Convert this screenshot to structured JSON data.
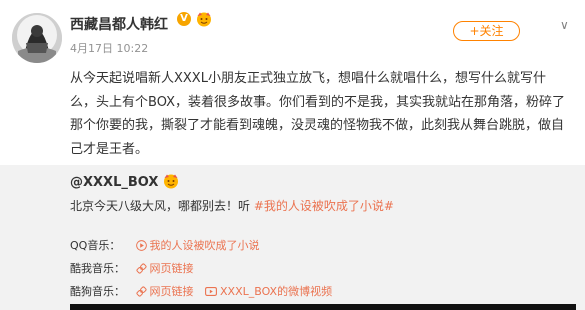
{
  "user": {
    "name": "西藏昌都人韩红",
    "verified_badge": "V",
    "timestamp": "4月17日 10:22"
  },
  "actions": {
    "follow_label": "+关注",
    "more_label": "∨"
  },
  "post": {
    "text": "从今天起说唱新人XXXL小朋友正式独立放飞，想唱什么就唱什么，想写什么就写什么，头上有个BOX，装着很多故事。你们看到的不是我，其实我就站在那角落，粉碎了那个你要的我，撕裂了才能看到魂魄，没灵魂的怪物我不做，此刻我从舞台跳脱，做自己才是王者。"
  },
  "repost": {
    "user": "@XXXL_BOX",
    "text_prefix": "北京今天八级大风，哪都别去！听 ",
    "hashtag": "#我的人设被吹成了小说#",
    "music": [
      {
        "label": "QQ音乐：",
        "links": [
          {
            "icon": "play-icon",
            "text": "我的人设被吹成了小说"
          }
        ]
      },
      {
        "label": "酷我音乐：",
        "links": [
          {
            "icon": "link-icon",
            "text": "网页链接"
          }
        ]
      },
      {
        "label": "酷狗音乐：",
        "links": [
          {
            "icon": "link-icon",
            "text": "网页链接"
          },
          {
            "icon": "video-icon",
            "text": "XXXL_BOX的微博视频"
          }
        ]
      }
    ]
  },
  "colors": {
    "accent": "#ff8200",
    "link": "#eb7350",
    "repost_bg": "#f2f2f2",
    "timestamp": "#939393"
  }
}
